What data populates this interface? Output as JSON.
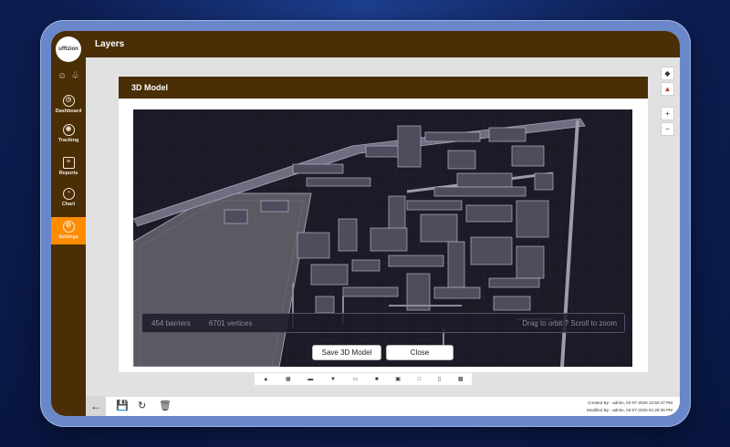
{
  "app": {
    "logo_text": "ufftzion",
    "page_title": "Layers"
  },
  "sidebar": {
    "top_icons": [
      "user-icon",
      "bell-icon"
    ],
    "items": [
      {
        "label": "Dashboard",
        "icon": "dashboard-icon",
        "active": false
      },
      {
        "label": "Tracking",
        "icon": "location-pin-icon",
        "active": false
      },
      {
        "label": "Reports",
        "icon": "report-icon",
        "active": false
      },
      {
        "label": "Chart",
        "icon": "pie-chart-icon",
        "active": false
      },
      {
        "label": "Settings",
        "icon": "gear-icon",
        "active": true
      }
    ]
  },
  "map_tools": {
    "layers_icon": "layers-icon",
    "compass_icon": "compass-icon",
    "zoom_in": "+",
    "zoom_out": "−"
  },
  "modal": {
    "title": "3D Model",
    "status": {
      "barriers": "454 barriers",
      "vertices": "6701 vertices",
      "hint": "Drag to orbit ? Scroll to zoom"
    },
    "save_label": "Save 3D Model",
    "close_label": "Close"
  },
  "footer": {
    "back_icon": "arrow-left-icon",
    "save_icon": "save-icon",
    "refresh_icon": "refresh-icon",
    "delete_icon": "trash-icon",
    "created_by": "Created By - admin, 02-07-2026 12:50:47 PM",
    "modified_by": "Modified By - admin, 02-07-2026 01:29:36 PM"
  },
  "colors": {
    "brand_brown": "#4a2e06",
    "accent_orange": "#ff8c00",
    "viewer_bg": "#1b1a26"
  }
}
